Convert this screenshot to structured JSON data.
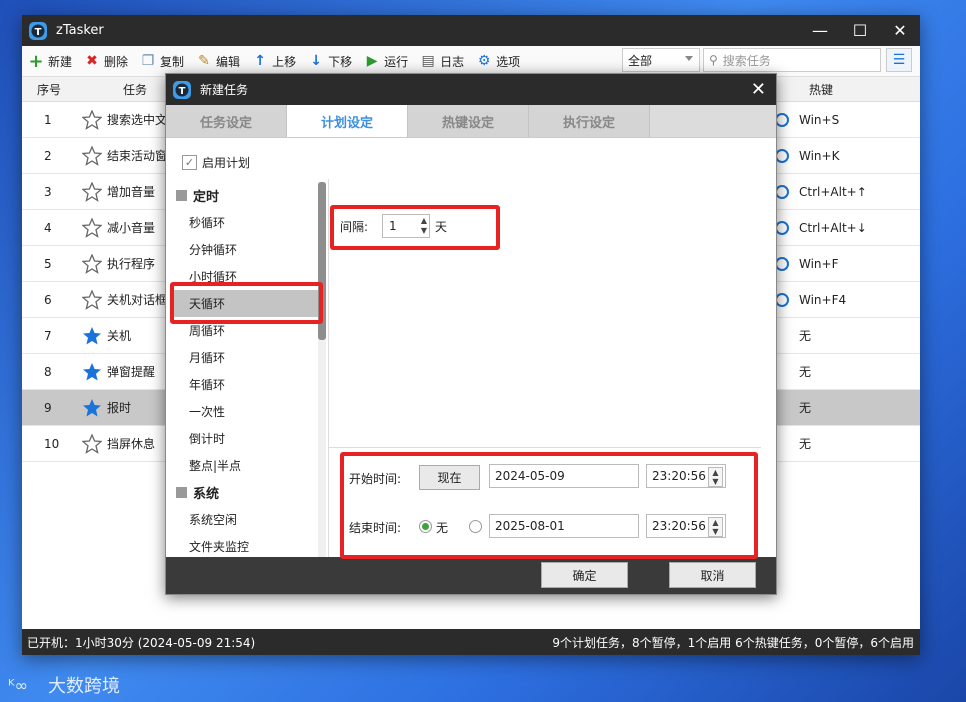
{
  "app": {
    "title": "zTasker",
    "win_min": "—",
    "win_max": "☐",
    "win_close": "✕"
  },
  "toolbar": {
    "new": "新建",
    "delete": "删除",
    "copy": "复制",
    "edit": "编辑",
    "up": "上移",
    "down": "下移",
    "run": "运行",
    "log": "日志",
    "options": "选项",
    "filter_value": "全部",
    "search_placeholder": "搜索任务"
  },
  "table": {
    "headers": {
      "num": "序号",
      "task": "任务",
      "hotkey": "热键"
    },
    "rows": [
      {
        "num": "1",
        "name": "搜索选中文",
        "hotkey": "Win+S",
        "starred": false,
        "radio": true
      },
      {
        "num": "2",
        "name": "结束活动窗",
        "hotkey": "Win+K",
        "starred": false,
        "radio": true
      },
      {
        "num": "3",
        "name": "增加音量",
        "hotkey": "Ctrl+Alt+↑",
        "starred": false,
        "radio": true
      },
      {
        "num": "4",
        "name": "减小音量",
        "hotkey": "Ctrl+Alt+↓",
        "starred": false,
        "radio": true
      },
      {
        "num": "5",
        "name": "执行程序",
        "hotkey": "Win+F",
        "starred": false,
        "radio": true
      },
      {
        "num": "6",
        "name": "关机对话框",
        "hotkey": "Win+F4",
        "starred": false,
        "radio": true
      },
      {
        "num": "7",
        "name": "关机",
        "hotkey": "无",
        "starred": true,
        "radio": false
      },
      {
        "num": "8",
        "name": "弹窗提醒",
        "hotkey": "无",
        "starred": true,
        "radio": false
      },
      {
        "num": "9",
        "name": "报时",
        "hotkey": "无",
        "starred": true,
        "radio": false,
        "selected": true
      },
      {
        "num": "10",
        "name": "挡屏休息",
        "hotkey": "无",
        "starred": false,
        "radio": false
      }
    ]
  },
  "status": {
    "left": "已开机：1小时30分 (2024-05-09 21:54)",
    "right": "9个计划任务，8个暂停，1个启用   6个热键任务，0个暂停，6个启用"
  },
  "dialog": {
    "title": "新建任务",
    "close": "✕",
    "tabs": [
      "任务设定",
      "计划设定",
      "热键设定",
      "执行设定"
    ],
    "active_tab": 1,
    "enable_label": "启用计划",
    "groups": [
      {
        "label": "定时",
        "items": [
          "秒循环",
          "分钟循环",
          "小时循环",
          "天循环",
          "周循环",
          "月循环",
          "年循环",
          "一次性",
          "倒计时",
          "整点|半点"
        ]
      },
      {
        "label": "系统",
        "items": [
          "系统空闲",
          "文件夹监控"
        ]
      }
    ],
    "selected_item": "天循环",
    "interval": {
      "label": "间隔:",
      "value": "1",
      "unit": "天"
    },
    "start": {
      "label": "开始时间:",
      "now_button": "现在",
      "date": "2024-05-09",
      "time": "23:20:56"
    },
    "end": {
      "label": "结束时间:",
      "none_label": "无",
      "date": "2025-08-01",
      "time": "23:20:56"
    },
    "ok": "确定",
    "cancel": "取消"
  },
  "watermark": "大数跨境",
  "colors": {
    "accent": "#1a73d8",
    "highlight": "#e82222",
    "titlebar": "#2b2b2b"
  }
}
